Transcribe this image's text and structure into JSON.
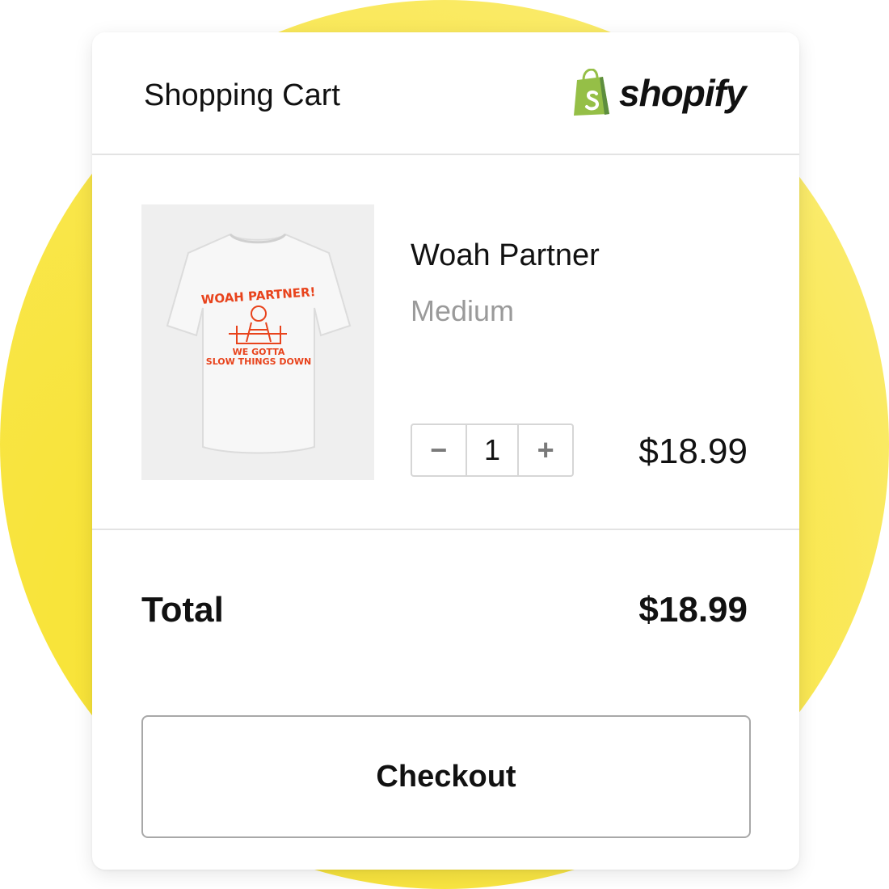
{
  "cart": {
    "title": "Shopping Cart"
  },
  "brand": {
    "name": "shopify",
    "icon": "shopify-bag-icon",
    "color": "#95bf47"
  },
  "item": {
    "name": "Woah Partner",
    "variant": "Medium",
    "quantity": "1",
    "decrement_label": "−",
    "increment_label": "+",
    "price": "$18.99",
    "image": {
      "icon": "tshirt-product-image",
      "print_headline": "WOAH PARTNER!",
      "print_line1": "WE GOTTA",
      "print_line2": "SLOW THINGS DOWN",
      "print_color": "#e8431c"
    }
  },
  "summary": {
    "total_label": "Total",
    "total_value": "$18.99"
  },
  "checkout": {
    "label": "Checkout"
  },
  "theme": {
    "accent_yellow": "#f7e22e"
  }
}
